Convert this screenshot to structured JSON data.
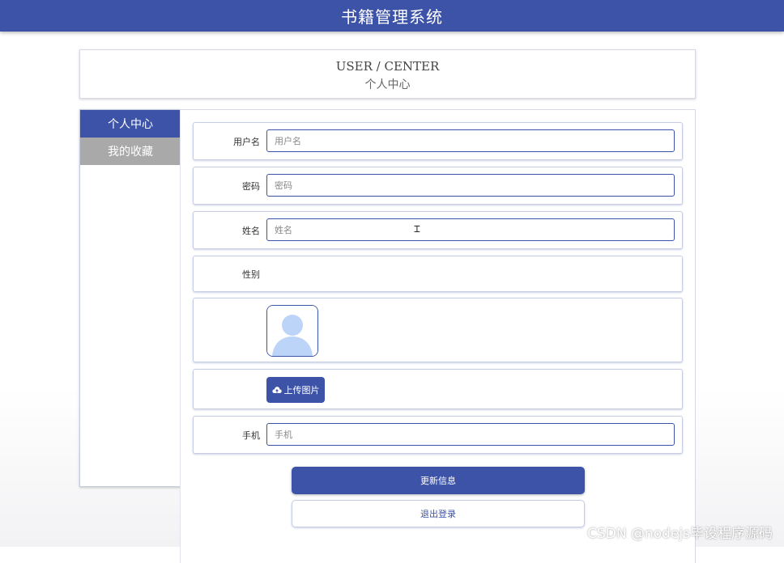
{
  "header": {
    "title": "书籍管理系统"
  },
  "page_title": {
    "en": "USER / CENTER",
    "cn": "个人中心"
  },
  "sidebar": {
    "items": [
      {
        "label": "个人中心",
        "active": true
      },
      {
        "label": "我的收藏",
        "active": false
      }
    ]
  },
  "form": {
    "username": {
      "label": "用户名",
      "placeholder": "用户名",
      "value": ""
    },
    "password": {
      "label": "密码",
      "placeholder": "密码",
      "value": ""
    },
    "name": {
      "label": "姓名",
      "placeholder": "姓名",
      "value": ""
    },
    "gender": {
      "label": "性别"
    },
    "upload_label": "上传图片",
    "phone": {
      "label": "手机",
      "placeholder": "手机",
      "value": ""
    }
  },
  "buttons": {
    "update": "更新信息",
    "logout": "退出登录"
  },
  "watermark": "CSDN @nodejs毕设程序源码",
  "colors": {
    "accent": "#3d53a8",
    "inactive_tab": "#a9a9a9"
  }
}
